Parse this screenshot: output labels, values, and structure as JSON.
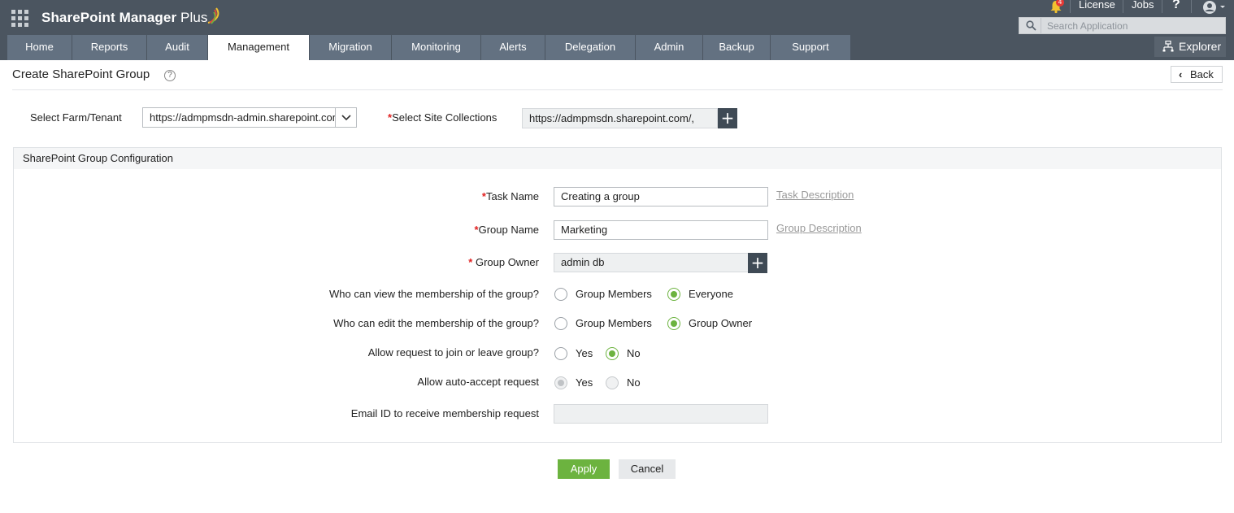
{
  "app": {
    "name": "SharePoint Manager",
    "name_suffix": "Plus",
    "accent_color": "#6cb33f",
    "header_color": "#4b5560"
  },
  "top_links": {
    "notification_count": "4",
    "license": "License",
    "jobs": "Jobs",
    "help": "?"
  },
  "search": {
    "placeholder": "Search Application"
  },
  "explorer": {
    "label": "Explorer"
  },
  "nav": {
    "tabs": [
      {
        "label": "Home"
      },
      {
        "label": "Reports"
      },
      {
        "label": "Audit"
      },
      {
        "label": "Management",
        "active": true
      },
      {
        "label": "Migration"
      },
      {
        "label": "Monitoring"
      },
      {
        "label": "Alerts"
      },
      {
        "label": "Delegation"
      },
      {
        "label": "Admin"
      },
      {
        "label": "Backup"
      },
      {
        "label": "Support"
      }
    ]
  },
  "page": {
    "title": "Create SharePoint Group",
    "help": "?",
    "back_label": "Back"
  },
  "selectors": {
    "farm_label": "Select Farm/Tenant",
    "farm_value": "https://admpmsdn-admin.sharepoint.com",
    "site_label": "Select Site Collections",
    "site_value": "https://admpmsdn.sharepoint.com/,"
  },
  "config": {
    "heading": "SharePoint Group Configuration",
    "task_name_label": "Task Name",
    "task_name_value": "Creating a group",
    "task_description_link": "Task Description",
    "group_name_label": "Group Name",
    "group_name_value": "Marketing",
    "group_description_link": "Group Description",
    "group_owner_label": "Group Owner",
    "group_owner_value": "admin db",
    "view_membership": {
      "label": "Who can view the membership of the group?",
      "options": [
        "Group Members",
        "Everyone"
      ],
      "selected": "Everyone"
    },
    "edit_membership": {
      "label": "Who can edit the membership of the group?",
      "options": [
        "Group Members",
        "Group Owner"
      ],
      "selected": "Group Owner"
    },
    "allow_request": {
      "label": "Allow request to join or leave group?",
      "options": [
        "Yes",
        "No"
      ],
      "selected": "No"
    },
    "auto_accept": {
      "label": "Allow auto-accept request",
      "options": [
        "Yes",
        "No"
      ],
      "selected": "Yes",
      "disabled": true
    },
    "email_label": "Email ID to receive membership request",
    "email_value": ""
  },
  "actions": {
    "apply": "Apply",
    "cancel": "Cancel"
  }
}
